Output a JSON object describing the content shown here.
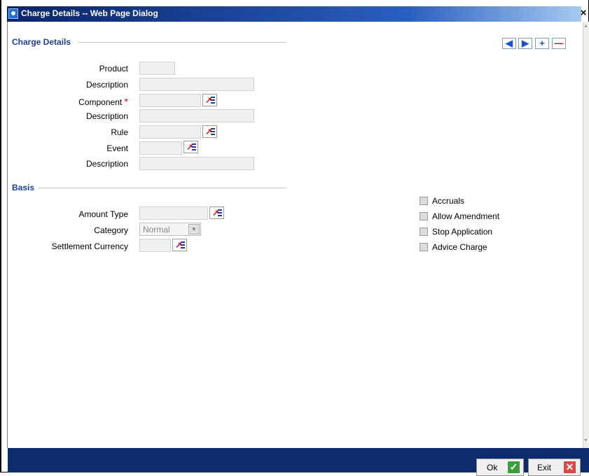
{
  "window": {
    "title": "Charge Details -- Web Page Dialog",
    "close_glyph": "×"
  },
  "nav_buttons": [
    {
      "name": "previous",
      "glyph": "◀"
    },
    {
      "name": "next",
      "glyph": "▶"
    },
    {
      "name": "add",
      "glyph": "+"
    },
    {
      "name": "delete",
      "glyph": "—"
    }
  ],
  "charge_details": {
    "section_title": "Charge Details",
    "product_label": "Product",
    "product_value": "",
    "product_description_label": "Description",
    "product_description_value": "",
    "component_label": "Component",
    "required_marker": "*",
    "component_value": "",
    "component_description_label": "Description",
    "component_description_value": "",
    "rule_label": "Rule",
    "rule_value": "",
    "event_label": "Event",
    "event_value": "",
    "event_description_label": "Description",
    "event_description_value": ""
  },
  "basis": {
    "section_title": "Basis",
    "amount_type_label": "Amount Type",
    "amount_type_value": "",
    "category_label": "Category",
    "category_selected": "Normal",
    "settlement_currency_label": "Settlement Currency",
    "settlement_currency_value": ""
  },
  "options": {
    "accruals_label": "Accruals",
    "allow_amendment_label": "Allow Amendment",
    "stop_application_label": "Stop Application",
    "advice_charge_label": "Advice Charge"
  },
  "footer": {
    "ok_label": "Ok",
    "exit_label": "Exit",
    "ok_glyph": "✓",
    "exit_glyph": "✕"
  },
  "colors": {
    "title_bar": "#0a246a",
    "section_title": "#1c3f94",
    "footer_bar": "#0d2c6b"
  }
}
